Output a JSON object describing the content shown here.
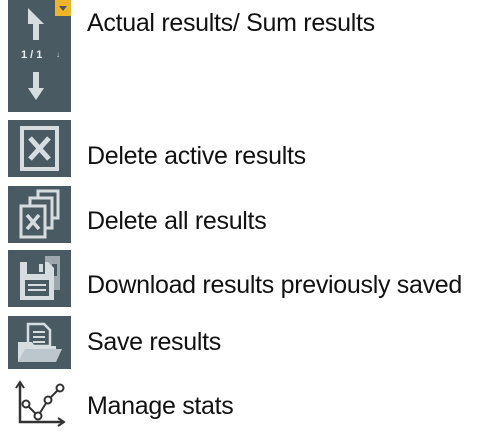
{
  "legend": {
    "items": [
      {
        "label": "Actual results/ Sum results",
        "icon": "navigation-arrows-icon",
        "counter": "1 / 1",
        "counter_suffix": "↓"
      },
      {
        "label": "Delete active results",
        "icon": "delete-active-icon"
      },
      {
        "label": "Delete all results",
        "icon": "delete-all-icon"
      },
      {
        "label": "Download results previously saved",
        "icon": "download-saved-icon"
      },
      {
        "label": "Save results",
        "icon": "save-folder-icon"
      },
      {
        "label": "Manage stats",
        "icon": "stats-graph-icon"
      }
    ]
  },
  "colors": {
    "icon_background": "#4a5a63",
    "icon_glyph": "#d5dde1",
    "badge": "#f0b429"
  }
}
